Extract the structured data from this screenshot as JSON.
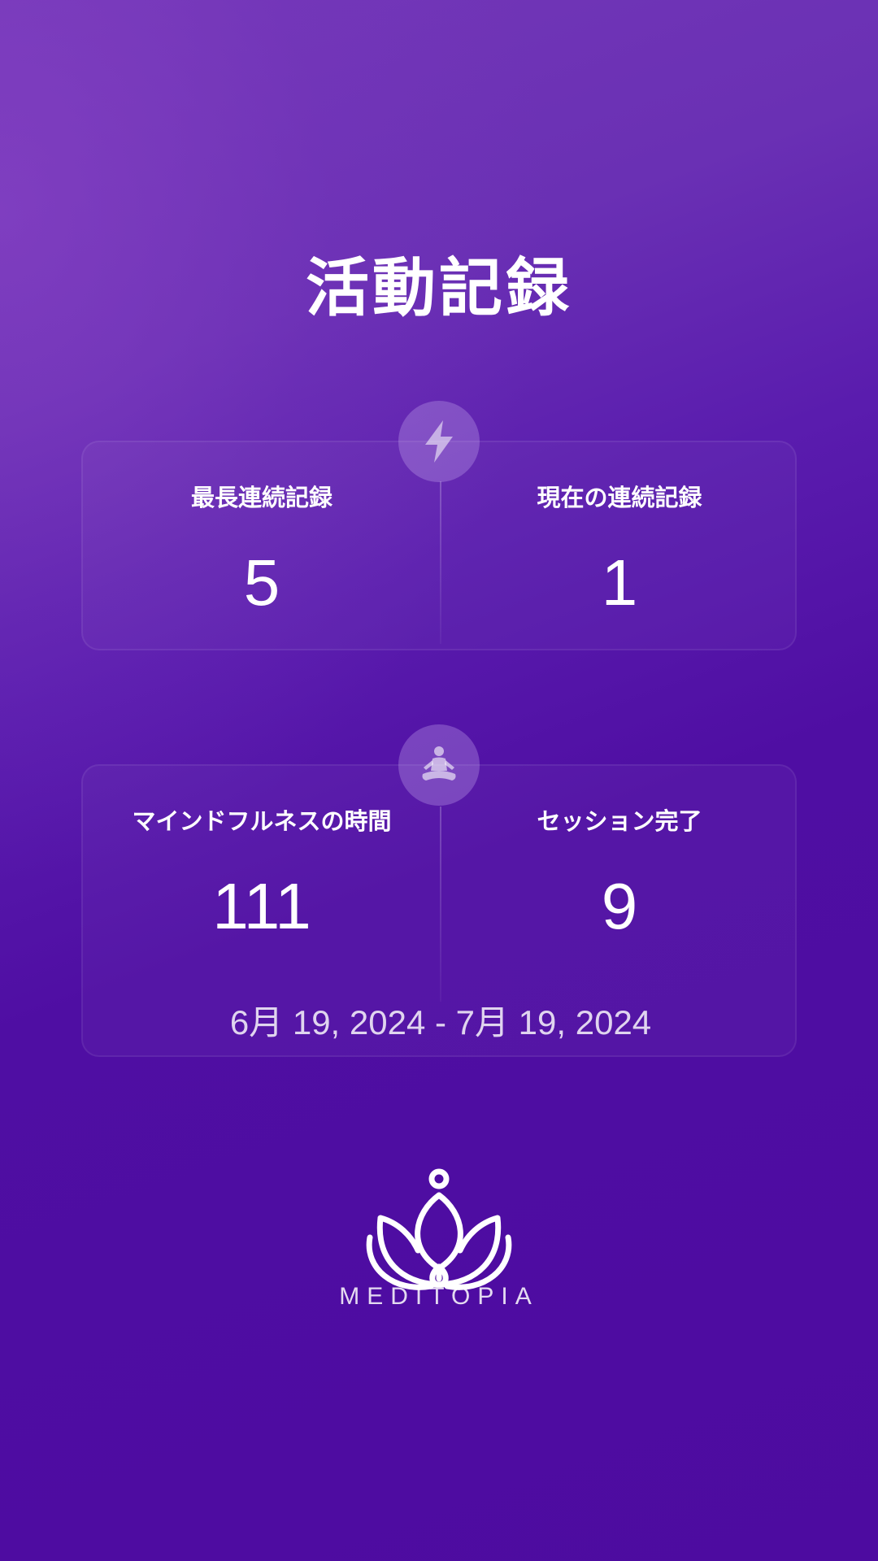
{
  "header": {
    "title": "活動記録"
  },
  "streak_card": {
    "icon": "lightning-bolt-icon",
    "longest_label": "最長連続記録",
    "longest_value": "5",
    "current_label": "現在の連続記録",
    "current_value": "1"
  },
  "mindfulness_card": {
    "icon": "meditation-person-icon",
    "minutes_label": "マインドフルネスの時間",
    "minutes_value": "111",
    "sessions_label": "セッション完了",
    "sessions_value": "9",
    "date_range": "6月 19, 2024 - 7月 19, 2024"
  },
  "branding": {
    "logo_icon": "lotus-logo-icon",
    "name": "MEDITOPIA"
  },
  "colors": {
    "background_top": "#7438b8",
    "background_bottom": "#4d0ba0",
    "text": "#ffffff"
  }
}
